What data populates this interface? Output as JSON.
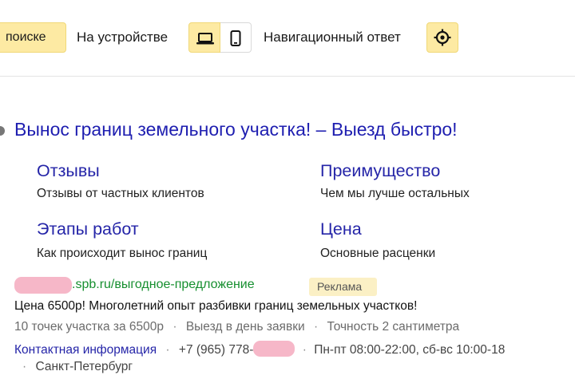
{
  "toolbar": {
    "search_label": "поиске",
    "device_label": "На устройстве",
    "nav_answer_label": "Навигационный ответ"
  },
  "ad": {
    "title": "Вынос границ земельного участка! – Выезд быстро!",
    "sitelinks": [
      {
        "title": "Отзывы",
        "desc": "Отзывы от частных клиентов"
      },
      {
        "title": "Преимущество",
        "desc": "Чем мы лучше остальных"
      },
      {
        "title": "Этапы работ",
        "desc": "Как происходит вынос границ"
      },
      {
        "title": "Цена",
        "desc": "Основные расценки"
      }
    ],
    "url_path": ".spb.ru/выгодное-предложение",
    "badge": "Реклама",
    "text": "Цена 6500р! Многолетний опыт разбивки границ земельных участков!",
    "callouts": [
      "10 точек участка за 6500р",
      "Выезд в день заявки",
      "Точность 2 сантиметра"
    ],
    "contact_link": "Контактная информация",
    "phone_prefix": "+7 (965) 778-",
    "hours": "Пн-пт 08:00-22:00, сб-вс 10:00-18",
    "city": "Санкт-Петербург",
    "separator": "·"
  },
  "colors": {
    "accent_yellow": "#fdeaa3",
    "link_blue": "#2525a8",
    "url_green": "#168f2f",
    "redaction_pink": "#f6b7c8"
  }
}
